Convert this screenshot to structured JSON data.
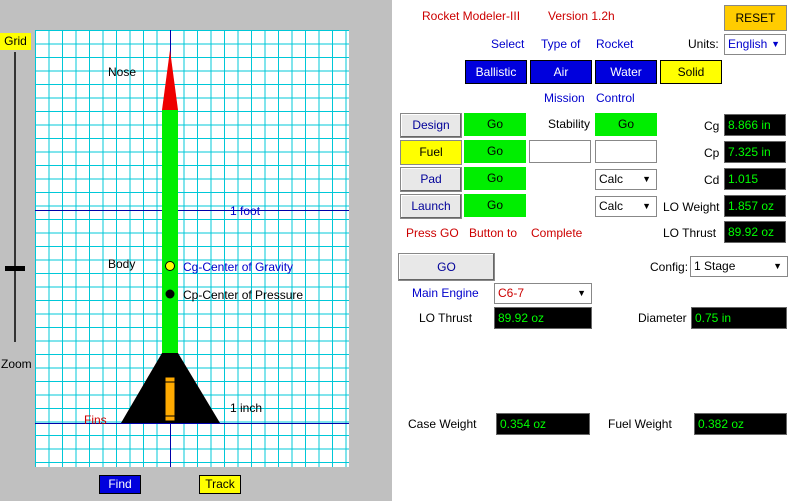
{
  "header": {
    "app_name": "Rocket  Modeler-III",
    "version_label": "Version  1.2h",
    "reset_label": "RESET"
  },
  "left": {
    "grid_label": "Grid",
    "zoom_label": "Zoom",
    "find_label": "Find",
    "track_label": "Track",
    "nose_label": "Nose",
    "body_label": "Body",
    "fins_label": "Fins",
    "foot_label": "1 foot",
    "inch_label": "1 inch",
    "cg_legend": "Cg-Center of Gravity",
    "cp_legend": "Cp-Center of Pressure"
  },
  "select": {
    "w1": "Select",
    "w2": "Type of",
    "w3": "Rocket",
    "units_label": "Units:",
    "units_value": "English",
    "types": [
      "Ballistic",
      "Air",
      "Water",
      "Solid"
    ]
  },
  "mission": {
    "w1": "Mission",
    "w2": "Control",
    "design_label": "Design",
    "fuel_label": "Fuel",
    "pad_label": "Pad",
    "launch_label": "Launch",
    "go_label": "Go",
    "stability_label": "Stability",
    "stability_go": "Go",
    "calc1": "Calc",
    "calc2": "Calc",
    "press_go": "Press GO",
    "button_to": "Button  to",
    "complete": "Complete"
  },
  "readouts": {
    "cg_label": "Cg",
    "cg_value": "8.866 in",
    "cp_label": "Cp",
    "cp_value": "7.325 in",
    "cd_label": "Cd",
    "cd_value": "1.015",
    "lo_weight_label": "LO Weight",
    "lo_weight_value": "1.857 oz",
    "lo_thrust_label": "LO Thrust",
    "lo_thrust_value": "89.92 oz"
  },
  "engine": {
    "go_button": "GO",
    "config_label": "Config:",
    "config_value": "1 Stage",
    "main_engine_label": "Main Engine",
    "main_engine_value": "C6-7",
    "lo_thrust_label": "LO Thrust",
    "lo_thrust_value": "89.92 oz",
    "diameter_label": "Diameter",
    "diameter_value": "0.75 in",
    "case_weight_label": "Case Weight",
    "case_weight_value": "0.354 oz",
    "fuel_weight_label": "Fuel Weight",
    "fuel_weight_value": "0.382 oz"
  },
  "colors": {
    "nose": "#ee0000",
    "body": "#00ee00",
    "fins": "#000000",
    "engine": "#ffaa00",
    "cg_dot": "#ffff00",
    "cp_dot": "#000000"
  }
}
